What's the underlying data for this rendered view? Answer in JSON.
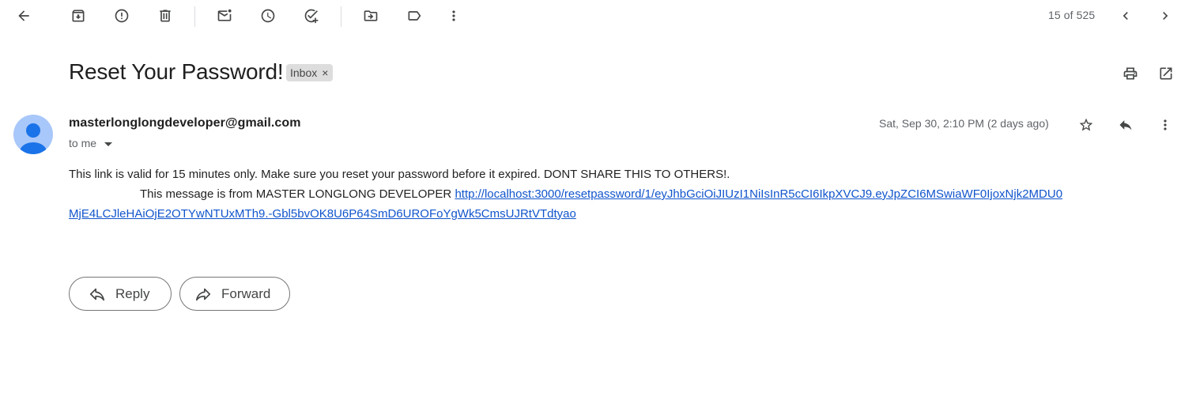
{
  "toolbar": {
    "icons": [
      "back-arrow-icon",
      "archive-icon",
      "report-spam-icon",
      "delete-icon",
      "mark-unread-icon",
      "snooze-icon",
      "add-to-tasks-icon",
      "move-to-icon",
      "label-icon",
      "more-vert-icon"
    ],
    "counter": "15 of 525",
    "older_icon": "chevron-left-icon",
    "newer_icon": "chevron-right-icon"
  },
  "email": {
    "subject": "Reset Your Password!",
    "label": "Inbox",
    "label_remove": "×",
    "sender": "masterlonglongdeveloper@gmail.com",
    "recipient": "to me",
    "date": "Sat, Sep 30, 2:10 PM (2 days ago)",
    "body_line1": "This link is valid for 15 minutes only. Make sure you reset your password before it expired. DONT SHARE THIS TO OTHERS!.",
    "body_line2_prefix": "This message is from MASTER LONGLONG DEVELOPER",
    "reset_link": "http://localhost:3000/resetpassword/1/eyJhbGciOiJIUzI1NiIsInR5cCI6IkpXVCJ9.eyJpZCI6MSwiaWF0IjoxNjk2MDU0MjE4LCJleHAiOjE2OTYwNTUxMTh9.-Gbl5bvOK8U6P64SmD6UROFoYgWk5CmsUJRtVTdtyao"
  },
  "actions": {
    "reply_label": "Reply",
    "forward_label": "Forward"
  },
  "colors": {
    "link": "#1155cc",
    "avatar_bg": "#a8c7fa",
    "avatar_fg": "#1a73e8",
    "chip_bg": "#dddddd"
  }
}
